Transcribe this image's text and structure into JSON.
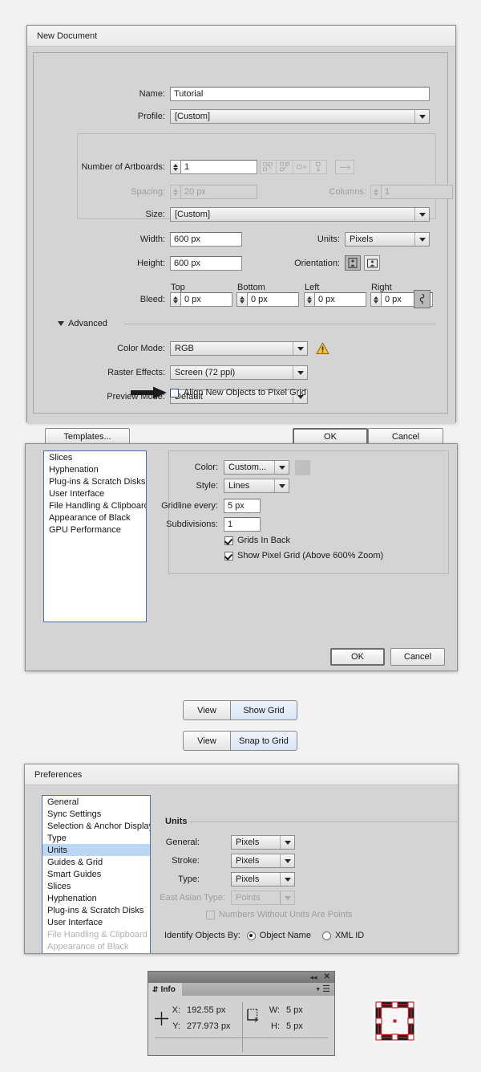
{
  "new_document": {
    "title": "New Document",
    "name_label": "Name:",
    "name_value": "Tutorial",
    "profile_label": "Profile:",
    "profile_value": "[Custom]",
    "artboards_label": "Number of Artboards:",
    "artboards_value": "1",
    "arrange_icons": [
      "grid-by-row-icon",
      "grid-by-column-icon",
      "arrange-by-row-icon",
      "arrange-by-column-icon"
    ],
    "arrange_order_icon": "change-to-right-to-left-icon",
    "spacing_label": "Spacing:",
    "spacing_value": "20 px",
    "columns_label": "Columns:",
    "columns_value": "1",
    "size_label": "Size:",
    "size_value": "[Custom]",
    "width_label": "Width:",
    "width_value": "600 px",
    "height_label": "Height:",
    "height_value": "600 px",
    "units_label": "Units:",
    "units_value": "Pixels",
    "orientation_label": "Orientation:",
    "orientation_portrait_icon": "orientation-portrait-icon",
    "orientation_landscape_icon": "orientation-landscape-icon",
    "bleed_label": "Bleed:",
    "bleed_top_label": "Top",
    "bleed_bottom_label": "Bottom",
    "bleed_left_label": "Left",
    "bleed_right_label": "Right",
    "bleed_top_value": "0 px",
    "bleed_bottom_value": "0 px",
    "bleed_left_value": "0 px",
    "bleed_right_value": "0 px",
    "bleed_link_icon": "link-chain-icon",
    "advanced_label": "Advanced",
    "advanced_disclosure_icon": "triangle-down-icon",
    "color_mode_label": "Color Mode:",
    "color_mode_value": "RGB",
    "warning_icon": "warning-triangle-icon",
    "raster_label": "Raster Effects:",
    "raster_value": "Screen (72 ppi)",
    "preview_label": "Preview Mode:",
    "preview_value": "Default",
    "align_pixel_label": "Align New Objects to Pixel Grid",
    "align_pixel_checked": false,
    "pointer_icon": "arrow-right-pointer-icon",
    "templates_label": "Templates...",
    "ok_label": "OK",
    "cancel_label": "Cancel"
  },
  "grid_prefs": {
    "categories": [
      "Slices",
      "Hyphenation",
      "Plug-ins & Scratch Disks",
      "User Interface",
      "File Handling & Clipboard",
      "Appearance of Black",
      "GPU Performance"
    ],
    "color_label": "Color:",
    "color_value": "Custom...",
    "color_swatch": "#c0c0c0",
    "style_label": "Style:",
    "style_value": "Lines",
    "gridline_label": "Gridline every:",
    "gridline_value": "5 px",
    "subdivisions_label": "Subdivisions:",
    "subdivisions_value": "1",
    "grids_in_back_label": "Grids In Back",
    "grids_in_back_checked": true,
    "show_pixel_grid_label": "Show Pixel Grid (Above 600% Zoom)",
    "show_pixel_grid_checked": true,
    "ok_label": "OK",
    "cancel_label": "Cancel"
  },
  "menu_paths": [
    {
      "menu": "View",
      "item": "Show Grid"
    },
    {
      "menu": "View",
      "item": "Snap to Grid"
    }
  ],
  "units_prefs": {
    "title": "Preferences",
    "categories": [
      {
        "label": "General",
        "state": "normal"
      },
      {
        "label": "Sync Settings",
        "state": "normal"
      },
      {
        "label": "Selection & Anchor Display",
        "state": "normal"
      },
      {
        "label": "Type",
        "state": "normal"
      },
      {
        "label": "Units",
        "state": "selected"
      },
      {
        "label": "Guides & Grid",
        "state": "normal"
      },
      {
        "label": "Smart Guides",
        "state": "normal"
      },
      {
        "label": "Slices",
        "state": "normal"
      },
      {
        "label": "Hyphenation",
        "state": "normal"
      },
      {
        "label": "Plug-ins & Scratch Disks",
        "state": "normal"
      },
      {
        "label": "User Interface",
        "state": "normal"
      },
      {
        "label": "File Handling & Clipboard",
        "state": "dimmed"
      },
      {
        "label": "Appearance of Black",
        "state": "dimmed"
      }
    ],
    "section_title": "Units",
    "general_label": "General:",
    "general_value": "Pixels",
    "stroke_label": "Stroke:",
    "stroke_value": "Pixels",
    "type_label": "Type:",
    "type_value": "Pixels",
    "east_asian_label": "East Asian Type:",
    "east_asian_value": "Points",
    "numbers_label": "Numbers Without Units Are Points",
    "numbers_checked": false,
    "identify_label": "Identify Objects By:",
    "identify_object_name": "Object Name",
    "identify_xml_id": "XML ID",
    "identify_selected": "Object Name"
  },
  "info_panel": {
    "tab_label": "Info",
    "collapse_icon": "double-chevron-left-icon",
    "close_icon": "close-x-icon",
    "menu_icon": "panel-menu-icon",
    "tab_drag_icon": "updown-arrows-icon",
    "crosshair_icon": "crosshair-icon",
    "wh_icon": "width-height-arrow-icon",
    "x_label": "X:",
    "x_value": "192.55 px",
    "y_label": "Y:",
    "y_value": "277.973 px",
    "w_label": "W:",
    "w_value": "5 px",
    "h_label": "H:",
    "h_value": "5 px"
  },
  "artwork": {
    "name": "selected-square-with-bounding-box",
    "stroke_color": "#c0232c",
    "fill_color": "#1c1c1c",
    "handle_color": "#ffffff"
  }
}
